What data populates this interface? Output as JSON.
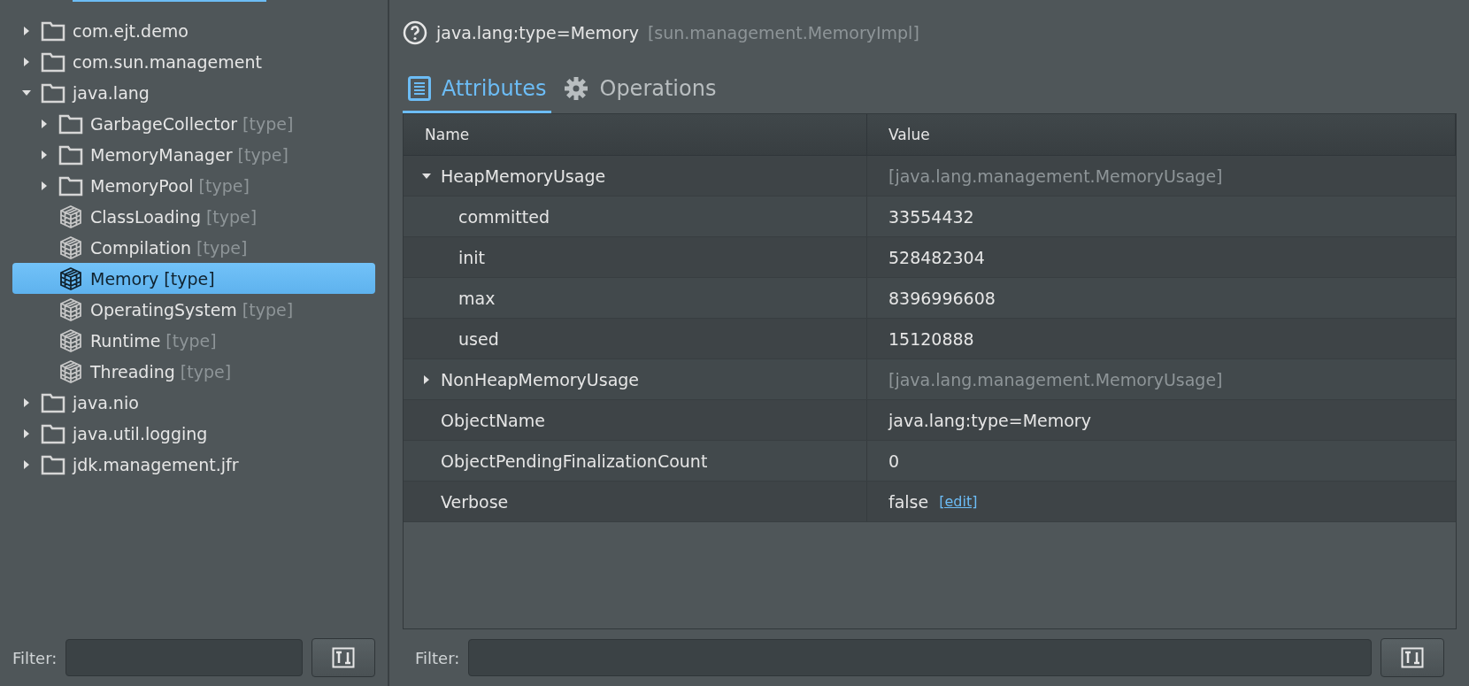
{
  "tree": {
    "items": [
      {
        "kind": "folder",
        "label": "com.ejt.demo",
        "expanded": false,
        "selected": false
      },
      {
        "kind": "folder",
        "label": "com.sun.management",
        "expanded": false,
        "selected": false
      },
      {
        "kind": "folder",
        "label": "java.lang",
        "expanded": true,
        "selected": false,
        "children": [
          {
            "kind": "folder",
            "label": "GarbageCollector",
            "suffix": "[type]",
            "expanded": false,
            "selected": false
          },
          {
            "kind": "folder",
            "label": "MemoryManager",
            "suffix": "[type]",
            "expanded": false,
            "selected": false
          },
          {
            "kind": "folder",
            "label": "MemoryPool",
            "suffix": "[type]",
            "expanded": false,
            "selected": false
          },
          {
            "kind": "mbean",
            "label": "ClassLoading",
            "suffix": "[type]",
            "selected": false
          },
          {
            "kind": "mbean",
            "label": "Compilation",
            "suffix": "[type]",
            "selected": false
          },
          {
            "kind": "mbean",
            "label": "Memory",
            "suffix": "[type]",
            "selected": true
          },
          {
            "kind": "mbean",
            "label": "OperatingSystem",
            "suffix": "[type]",
            "selected": false
          },
          {
            "kind": "mbean",
            "label": "Runtime",
            "suffix": "[type]",
            "selected": false
          },
          {
            "kind": "mbean",
            "label": "Threading",
            "suffix": "[type]",
            "selected": false
          }
        ]
      },
      {
        "kind": "folder",
        "label": "java.nio",
        "expanded": false,
        "selected": false
      },
      {
        "kind": "folder",
        "label": "java.util.logging",
        "expanded": false,
        "selected": false
      },
      {
        "kind": "folder",
        "label": "jdk.management.jfr",
        "expanded": false,
        "selected": false
      }
    ]
  },
  "tree_filter": {
    "label": "Filter:"
  },
  "mbean": {
    "object_name": "java.lang:type=Memory",
    "class_name": "[sun.management.MemoryImpl]"
  },
  "tabs": [
    {
      "kind": "attributes",
      "label": "Attributes",
      "selected": true
    },
    {
      "kind": "operations",
      "label": "Operations",
      "selected": false
    }
  ],
  "table": {
    "columns": [
      "Name",
      "Value"
    ],
    "rows": [
      {
        "kind": "composite",
        "name": "HeapMemoryUsage",
        "value": "[java.lang.management.MemoryUsage]",
        "expanded": true,
        "children": [
          {
            "kind": "simple",
            "name": "committed",
            "value": "33554432"
          },
          {
            "kind": "simple",
            "name": "init",
            "value": "528482304"
          },
          {
            "kind": "simple",
            "name": "max",
            "value": "8396996608"
          },
          {
            "kind": "simple",
            "name": "used",
            "value": "15120888"
          }
        ]
      },
      {
        "kind": "composite",
        "name": "NonHeapMemoryUsage",
        "value": "[java.lang.management.MemoryUsage]",
        "expanded": false
      },
      {
        "kind": "simple",
        "name": "ObjectName",
        "value": "java.lang:type=Memory"
      },
      {
        "kind": "simple",
        "name": "ObjectPendingFinalizationCount",
        "value": "0"
      },
      {
        "kind": "simple",
        "name": "Verbose",
        "value": "false",
        "edit_link": "[edit]"
      }
    ]
  },
  "attribute_filter": {
    "label": "Filter:"
  }
}
